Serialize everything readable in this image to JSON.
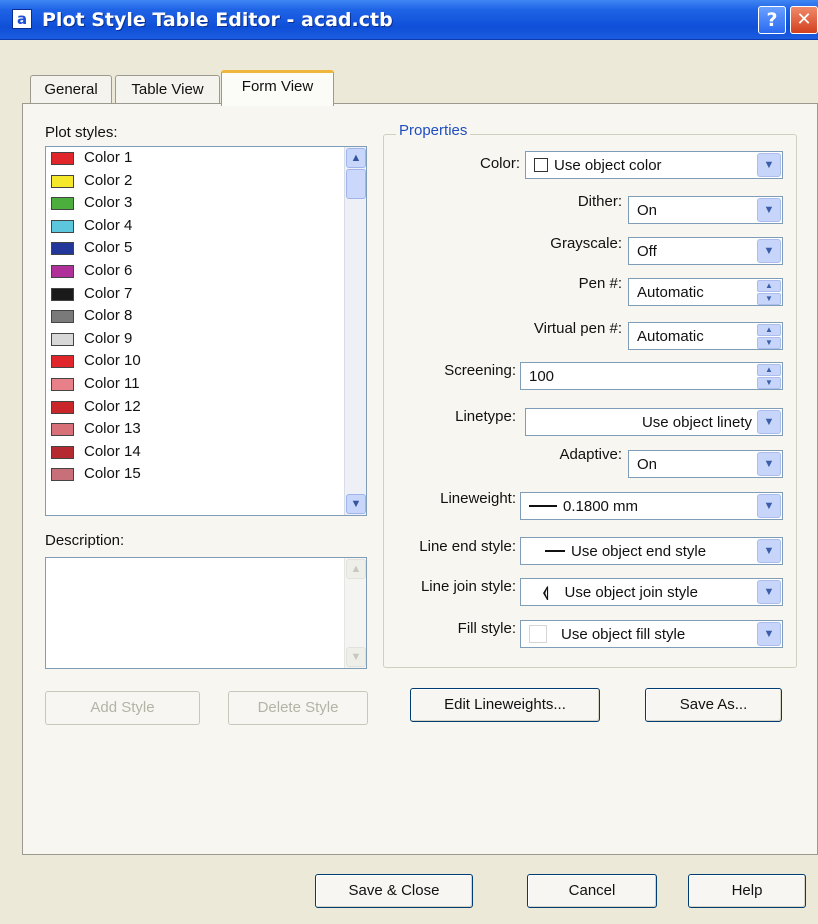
{
  "window": {
    "title": "Plot Style Table Editor - acad.ctb",
    "app_icon_glyph": "a",
    "help_glyph": "?",
    "close_glyph": "✕"
  },
  "tabs": [
    {
      "label": "General",
      "active": false
    },
    {
      "label": "Table View",
      "active": false
    },
    {
      "label": "Form View",
      "active": true
    }
  ],
  "plot_styles": {
    "label": "Plot styles:",
    "selected_index": 0,
    "items": [
      {
        "label": "Color 1",
        "color": "#e0262a"
      },
      {
        "label": "Color 2",
        "color": "#f5e82a"
      },
      {
        "label": "Color 3",
        "color": "#4cae3c"
      },
      {
        "label": "Color 4",
        "color": "#5cc6dc"
      },
      {
        "label": "Color 5",
        "color": "#23379a"
      },
      {
        "label": "Color 6",
        "color": "#b0309a"
      },
      {
        "label": "Color 7",
        "color": "#1a1a1a"
      },
      {
        "label": "Color 8",
        "color": "#7a7a7a"
      },
      {
        "label": "Color 9",
        "color": "#d8d8d8"
      },
      {
        "label": "Color 10",
        "color": "#e0262a"
      },
      {
        "label": "Color 11",
        "color": "#e8808a"
      },
      {
        "label": "Color 12",
        "color": "#c8262a"
      },
      {
        "label": "Color 13",
        "color": "#d8707a"
      },
      {
        "label": "Color 14",
        "color": "#b42a30"
      },
      {
        "label": "Color 15",
        "color": "#c8707a"
      }
    ]
  },
  "description": {
    "label": "Description:",
    "value": ""
  },
  "properties": {
    "title": "Properties",
    "color": {
      "label": "Color:",
      "value": "Use object color"
    },
    "dither": {
      "label": "Dither:",
      "value": "On"
    },
    "grayscale": {
      "label": "Grayscale:",
      "value": "Off"
    },
    "pen": {
      "label": "Pen #:",
      "value": "Automatic"
    },
    "virtual_pen": {
      "label": "Virtual pen #:",
      "value": "Automatic"
    },
    "screening": {
      "label": "Screening:",
      "value": "100"
    },
    "linetype": {
      "label": "Linetype:",
      "value": "Use object linety"
    },
    "adaptive": {
      "label": "Adaptive:",
      "value": "On"
    },
    "lineweight": {
      "label": "Lineweight:",
      "value": "0.1800 mm"
    },
    "line_end_style": {
      "label": "Line end style:",
      "value": "Use object end style"
    },
    "line_join_style": {
      "label": "Line join style:",
      "value": "Use object join style",
      "glyph": "⦉"
    },
    "fill_style": {
      "label": "Fill style:",
      "value": "Use object fill style"
    }
  },
  "buttons": {
    "add_style": "Add Style",
    "delete_style": "Delete Style",
    "edit_lineweights": "Edit Lineweights...",
    "save_as": "Save As...",
    "save_close": "Save & Close",
    "cancel": "Cancel",
    "help": "Help"
  },
  "icons": {
    "scroll_up": "▲",
    "scroll_down": "▼",
    "dropdown": "▼",
    "spin_up": "▲",
    "spin_down": "▼"
  }
}
